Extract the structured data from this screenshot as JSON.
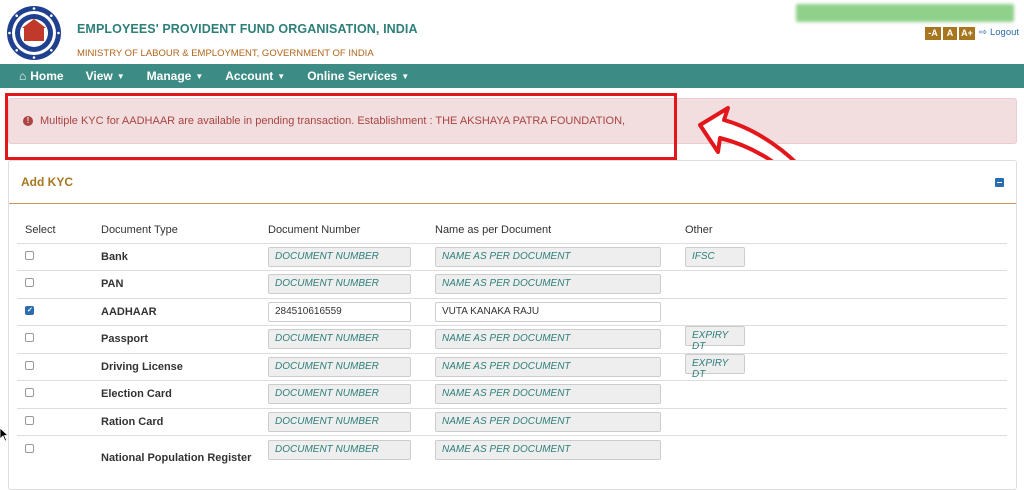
{
  "header": {
    "org_name": "EMPLOYEES' PROVIDENT FUND ORGANISATION, INDIA",
    "ministry": "MINISTRY OF LABOUR & EMPLOYMENT, GOVERNMENT OF INDIA",
    "font_buttons": [
      "-A",
      "A",
      "A+"
    ],
    "logout_label": "Logout"
  },
  "nav": {
    "items": [
      {
        "label": "Home",
        "icon": "home-icon"
      },
      {
        "label": "View"
      },
      {
        "label": "Manage"
      },
      {
        "label": "Account"
      },
      {
        "label": "Online Services"
      }
    ]
  },
  "alert": {
    "message": "Multiple KYC for AADHAAR are available in pending transaction. Establishment : THE AKSHAYA PATRA FOUNDATION,"
  },
  "panel": {
    "title": "Add KYC"
  },
  "table": {
    "headers": [
      "Select",
      "Document Type",
      "Document Number",
      "Name as per Document",
      "Other"
    ],
    "rows": [
      {
        "doc": "Bank",
        "checked": false,
        "number": "",
        "number_ph": "DOCUMENT NUMBER",
        "name": "",
        "name_ph": "NAME AS PER DOCUMENT",
        "other_ph": "IFSC"
      },
      {
        "doc": "PAN",
        "checked": false,
        "number": "",
        "number_ph": "DOCUMENT NUMBER",
        "name": "",
        "name_ph": "NAME AS PER DOCUMENT",
        "other_ph": ""
      },
      {
        "doc": "AADHAAR",
        "checked": true,
        "number": "284510616559",
        "number_ph": "",
        "name": "VUTA KANAKA RAJU",
        "name_ph": "",
        "other_ph": ""
      },
      {
        "doc": "Passport",
        "checked": false,
        "number": "",
        "number_ph": "DOCUMENT NUMBER",
        "name": "",
        "name_ph": "NAME AS PER DOCUMENT",
        "other_ph": "EXPIRY DT"
      },
      {
        "doc": "Driving License",
        "checked": false,
        "number": "",
        "number_ph": "DOCUMENT NUMBER",
        "name": "",
        "name_ph": "NAME AS PER DOCUMENT",
        "other_ph": "EXPIRY DT"
      },
      {
        "doc": "Election Card",
        "checked": false,
        "number": "",
        "number_ph": "DOCUMENT NUMBER",
        "name": "",
        "name_ph": "NAME AS PER DOCUMENT",
        "other_ph": ""
      },
      {
        "doc": "Ration Card",
        "checked": false,
        "number": "",
        "number_ph": "DOCUMENT NUMBER",
        "name": "",
        "name_ph": "NAME AS PER DOCUMENT",
        "other_ph": ""
      },
      {
        "doc": "National Population Register",
        "checked": false,
        "number": "",
        "number_ph": "DOCUMENT NUMBER",
        "name": "",
        "name_ph": "NAME AS PER DOCUMENT",
        "other_ph": ""
      }
    ]
  },
  "colors": {
    "nav_bg": "#3d8b85",
    "org_text": "#2e7f7a",
    "ministry_text": "#b06418",
    "alert_bg": "#f2dede",
    "alert_text": "#a94442",
    "highlight_red": "#e3171b",
    "panel_title": "#a7761f"
  }
}
